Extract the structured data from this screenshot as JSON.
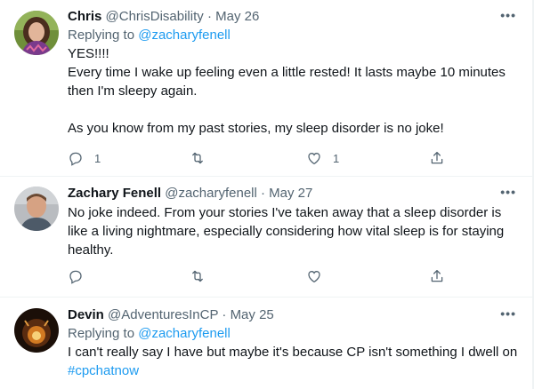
{
  "tweets": [
    {
      "name": "Chris",
      "handle": "@ChrisDisability",
      "sep": "·",
      "date": "May 26",
      "replying_prefix": "Replying to ",
      "replying_to": "@zacharyfenell",
      "lines": [
        "YES!!!!",
        "Every time I wake up feeling even a little rested! It lasts maybe 10 minutes",
        "then I'm sleepy again.",
        "",
        "As you know from my past stories, my sleep disorder is no joke!"
      ],
      "reply_count": "1",
      "retweet_count": "",
      "like_count": "1"
    },
    {
      "name": "Zachary Fenell",
      "handle": "@zacharyfenell",
      "sep": "·",
      "date": "May 27",
      "lines": [
        "No joke indeed. From your stories I've taken away that a sleep disorder is",
        "like a living nightmare, especially considering how vital sleep is for staying",
        "healthy."
      ],
      "reply_count": "",
      "retweet_count": "",
      "like_count": ""
    },
    {
      "name": "Devin",
      "handle": "@AdventuresInCP",
      "sep": "·",
      "date": "May 25",
      "replying_prefix": "Replying to ",
      "replying_to": "@zacharyfenell",
      "lines": [
        "I can't really say I have but maybe it's because CP isn't something I dwell on"
      ],
      "hashtag": "#cpchatnow"
    }
  ],
  "more_label": "•••",
  "colors": {
    "accent": "#1d9bf0",
    "secondary_text": "#536471",
    "divider": "#eff3f4"
  },
  "icons": [
    "reply-icon",
    "retweet-icon",
    "like-icon",
    "share-icon",
    "more-icon"
  ]
}
